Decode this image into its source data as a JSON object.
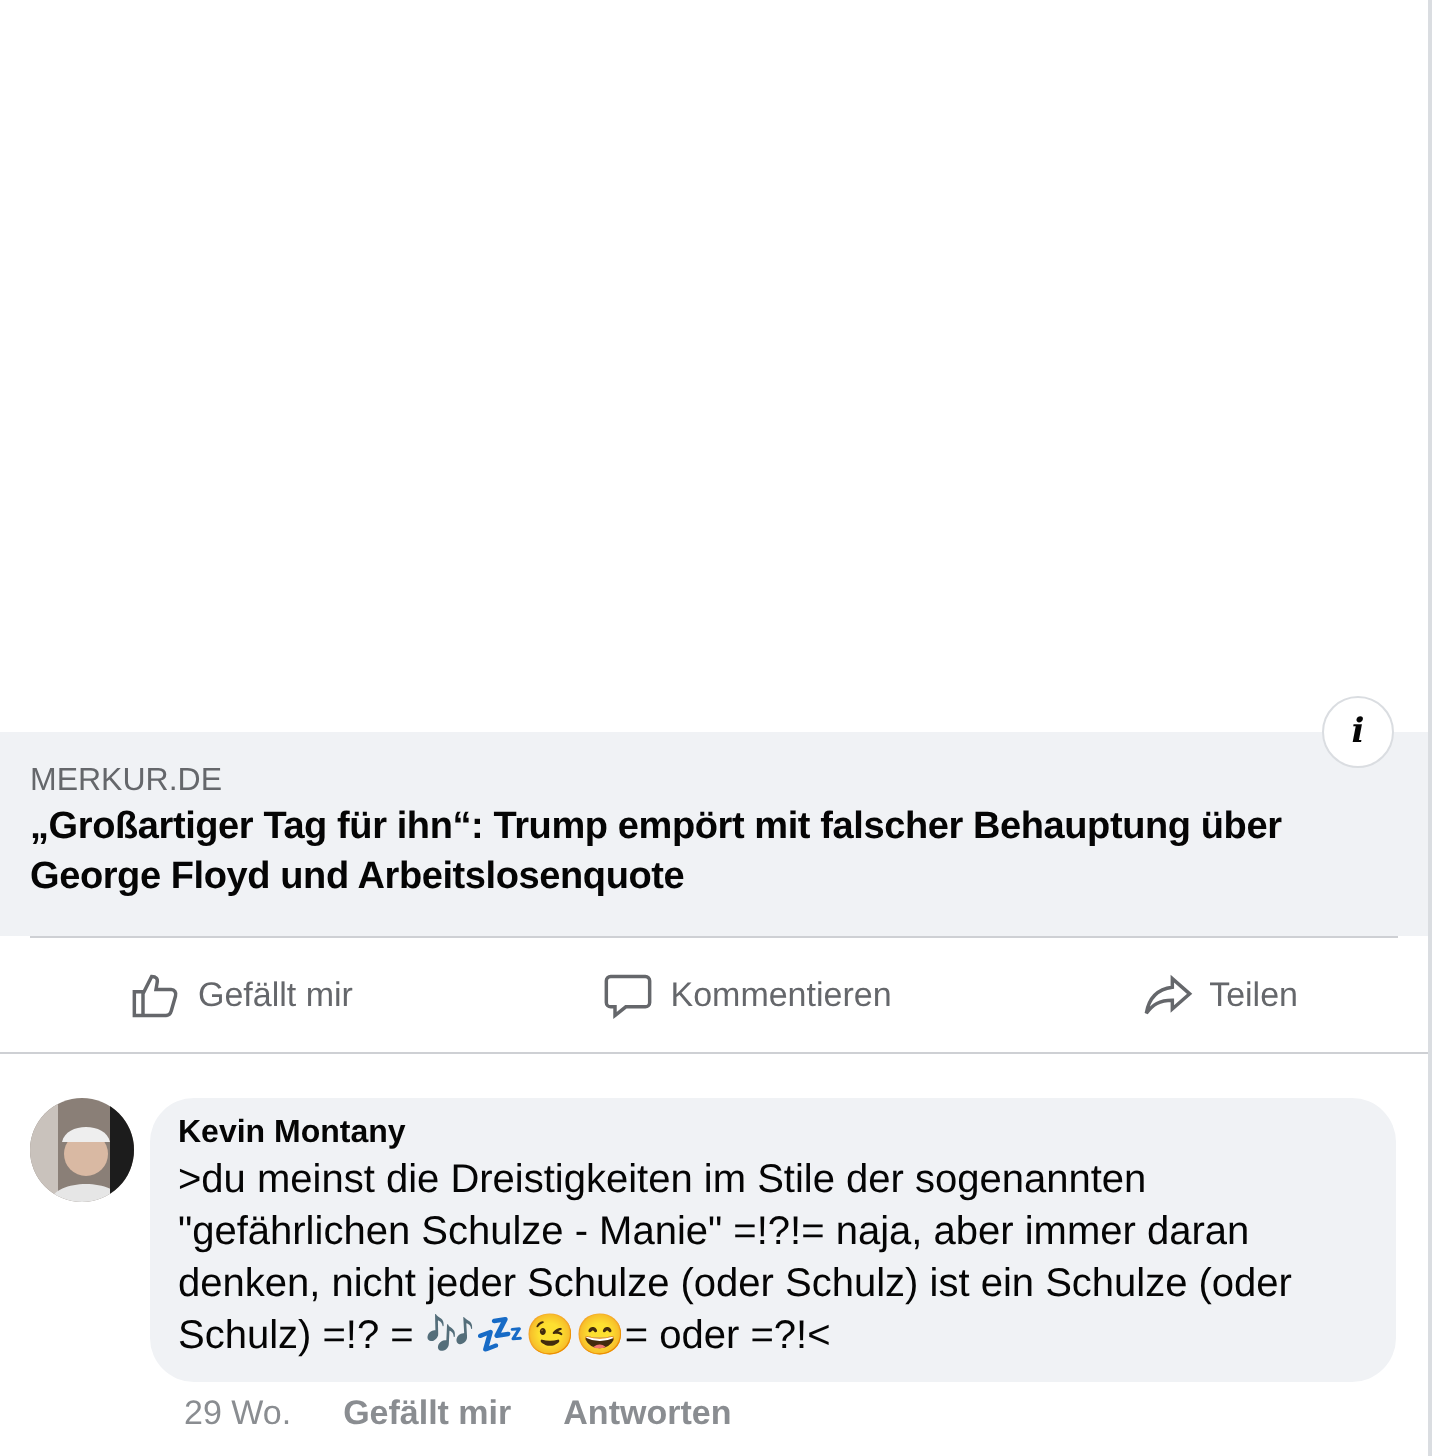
{
  "link_preview": {
    "domain": "MERKUR.DE",
    "title": "„Großartiger Tag für ihn“: Trump empört mit falscher Behauptung über George Floyd und Arbeitslosenquote",
    "info_button": "i"
  },
  "actions": [
    {
      "kind": "like",
      "label": "Gefällt mir"
    },
    {
      "kind": "comment",
      "label": "Kommentieren"
    },
    {
      "kind": "share",
      "label": "Teilen"
    }
  ],
  "comment": {
    "author": "Kevin Montany",
    "text": ">du meinst die Dreistigkeiten im Stile der sogenannten \"gefährlichen Schulze - Manie\" =!?!= naja, aber immer daran denken, nicht jeder Schulze (oder Schulz) ist ein Schulze (oder Schulz) =!? = 🎶💤😉😄=  oder =?!<",
    "time": "29 Wo.",
    "like": "Gefällt mir",
    "reply": "Antworten"
  }
}
